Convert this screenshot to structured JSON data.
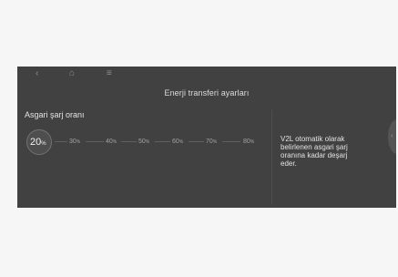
{
  "nav": {
    "back_icon": "‹",
    "home_icon": "⌂",
    "menu_icon": "≡"
  },
  "screen": {
    "title": "Enerji transferi ayarları"
  },
  "charge_setting": {
    "label": "Asgari şarj oranı",
    "selected_value": "20",
    "options": [
      {
        "value": "20",
        "unit": "%"
      },
      {
        "value": "30",
        "unit": "%"
      },
      {
        "value": "40",
        "unit": "%"
      },
      {
        "value": "50",
        "unit": "%"
      },
      {
        "value": "60",
        "unit": "%"
      },
      {
        "value": "70",
        "unit": "%"
      },
      {
        "value": "80",
        "unit": "%"
      }
    ]
  },
  "info": {
    "text": "V2L otomatik olarak belirlenen asgari şarj oranına kadar deşarj eder."
  },
  "edge": {
    "chevron": "‹"
  },
  "colors": {
    "screen_bg": "#414141",
    "page_bg": "#f6f6f6",
    "text_primary": "#e4e4e4",
    "text_muted": "#a2a2a2"
  }
}
